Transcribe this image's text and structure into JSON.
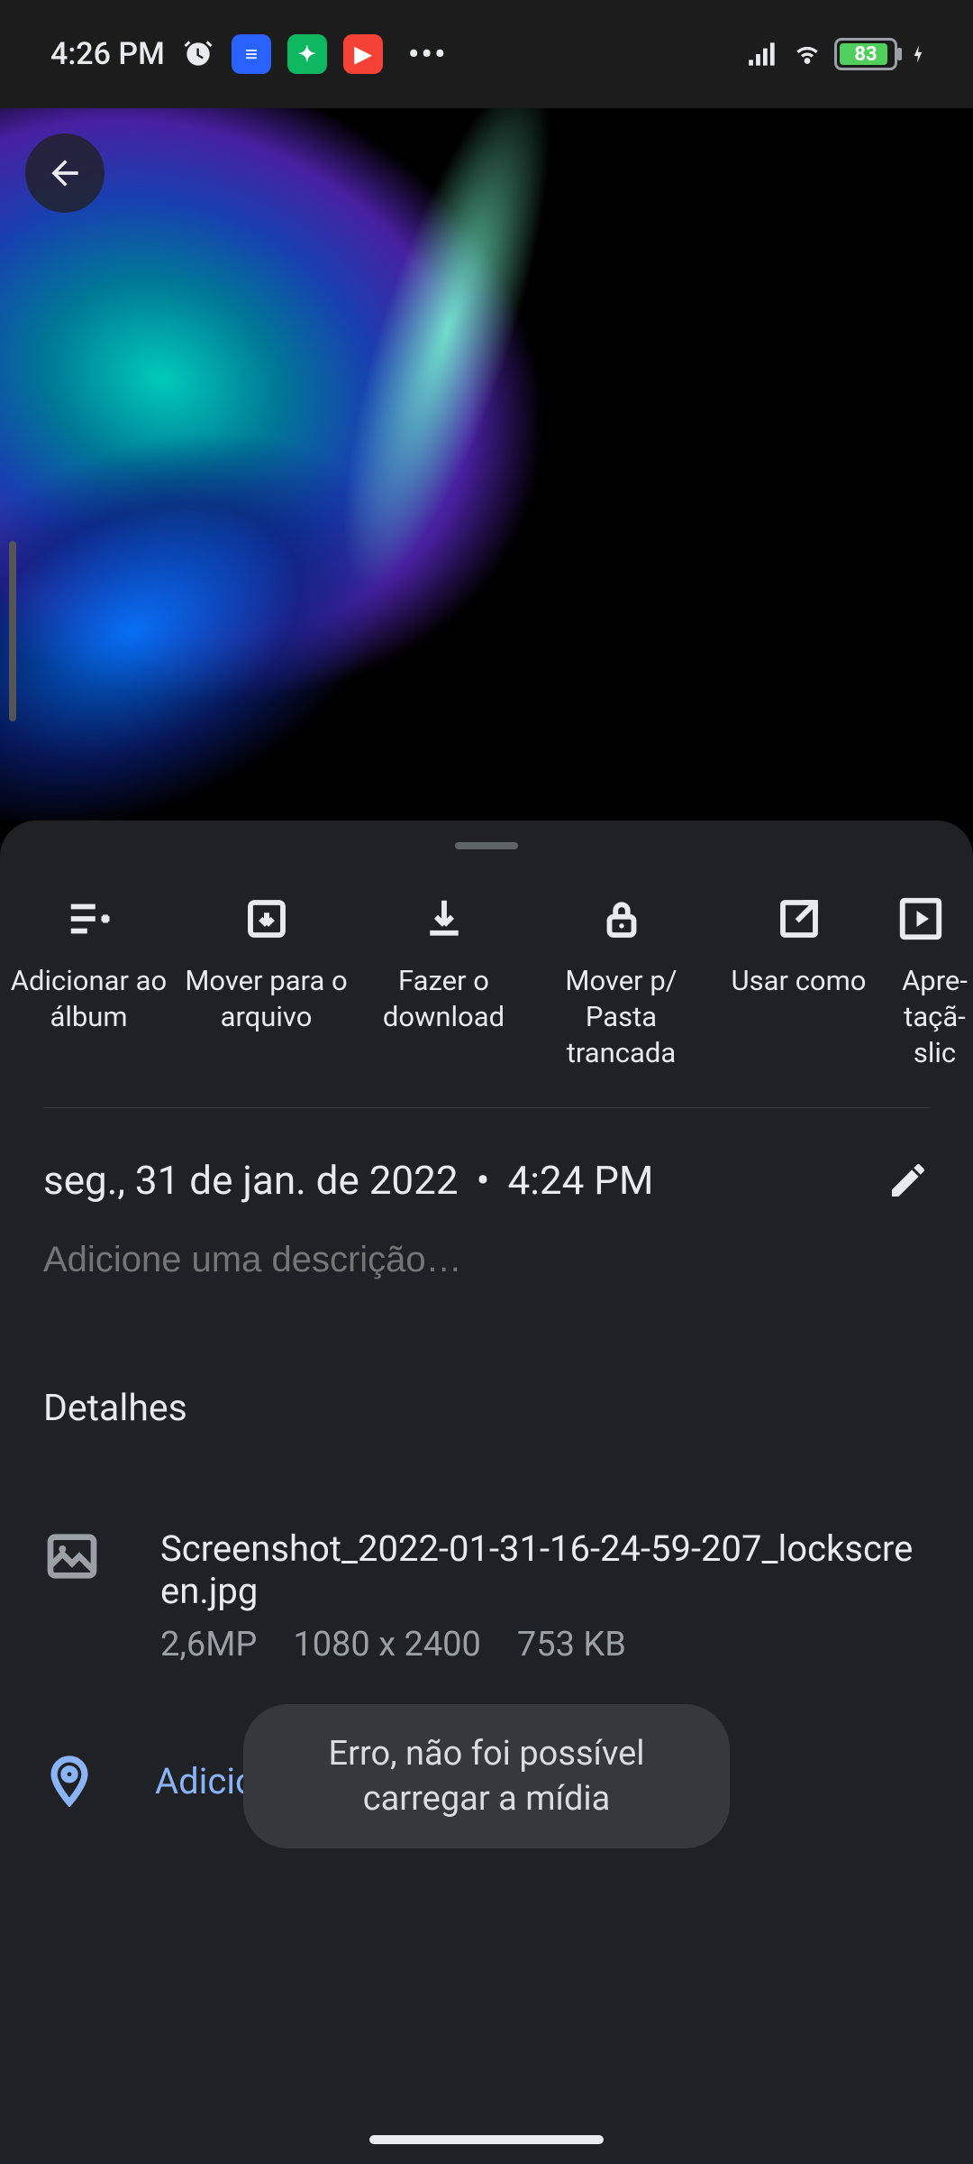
{
  "statusbar": {
    "time": "4:26 PM",
    "battery_pct": "83"
  },
  "actions": [
    {
      "label": "Adicionar ao álbum"
    },
    {
      "label": "Mover para o arquivo"
    },
    {
      "label": "Fazer o download"
    },
    {
      "label": "Mover p/ Pasta trancada"
    },
    {
      "label": "Usar como"
    },
    {
      "label": "Apre­taçã­slic"
    }
  ],
  "info": {
    "date": "seg., 31 de jan. de 2022",
    "time": "4:24 PM",
    "description_placeholder": "Adicione uma descrição…",
    "details_heading": "Detalhes",
    "file": {
      "name": "Screenshot_2022-01-31-16-24-59-207_lockscreen.jpg",
      "megapixels": "2,6MP",
      "dimensions": "1080 x 2400",
      "size": "753 KB"
    },
    "location_link": "Adicionar um local"
  },
  "toast": "Erro, não foi possível carregar a mídia"
}
